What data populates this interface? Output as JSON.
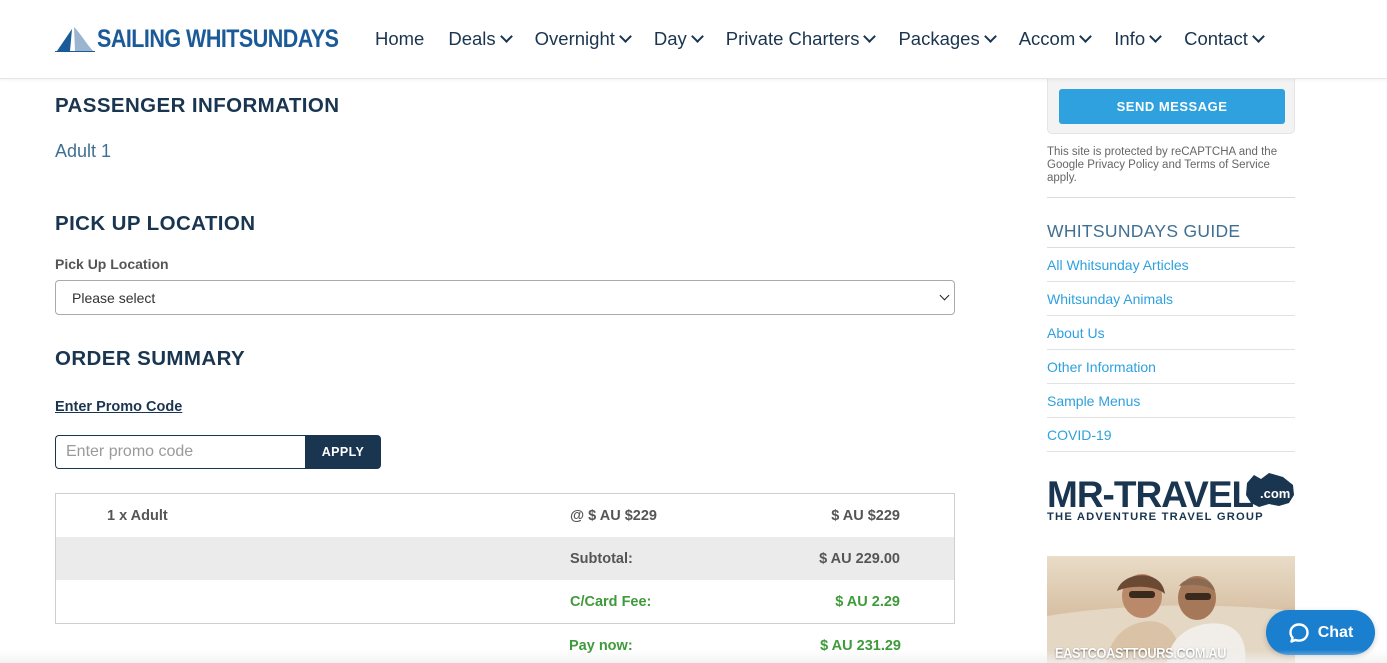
{
  "brand": {
    "name": "SAILING WHITSUNDAYS",
    "color": "#1b5a99"
  },
  "nav": {
    "items": [
      {
        "label": "Home",
        "dropdown": false
      },
      {
        "label": "Deals",
        "dropdown": true
      },
      {
        "label": "Overnight",
        "dropdown": true
      },
      {
        "label": "Day",
        "dropdown": true
      },
      {
        "label": "Private Charters",
        "dropdown": true
      },
      {
        "label": "Packages",
        "dropdown": true
      },
      {
        "label": "Accom",
        "dropdown": true
      },
      {
        "label": "Info",
        "dropdown": true
      },
      {
        "label": "Contact",
        "dropdown": true
      }
    ]
  },
  "passenger": {
    "heading": "PASSENGER INFORMATION",
    "adult": "Adult 1"
  },
  "pickup": {
    "heading": "PICK UP LOCATION",
    "label": "Pick Up Location",
    "selected": "Please select"
  },
  "order": {
    "heading": "ORDER SUMMARY",
    "promo_link": "Enter Promo Code",
    "promo_placeholder": "Enter promo code",
    "apply_label": "APPLY",
    "line": {
      "item": "1 x Adult",
      "unit": "@ $ AU $229",
      "total": "$ AU $229"
    },
    "subtotal": {
      "label": "Subtotal:",
      "value": "$ AU 229.00"
    },
    "card_fee": {
      "label": "C/Card Fee:",
      "value": "$ AU 2.29"
    },
    "pay_now": {
      "label": "Pay now:",
      "value": "$ AU 231.29"
    }
  },
  "sidebar": {
    "send_label": "SEND MESSAGE",
    "recaptcha": "This site is protected by reCAPTCHA and the Google Privacy Policy and Terms of Service apply.",
    "guide_title": "WHITSUNDAYS GUIDE",
    "guide_items": [
      "All Whitsunday Articles",
      "Whitsunday Animals",
      "About Us",
      "Other Information",
      "Sample Menus",
      "COVID-19"
    ],
    "mr_travel": {
      "name": "MR-TRAVEL",
      "tld": ".com",
      "tagline": "THE ADVENTURE TRAVEL GROUP"
    },
    "promo_caption": "EASTCOASTTOURS.COM.AU"
  },
  "chat": {
    "label": "Chat"
  },
  "colors": {
    "navy": "#1a3550",
    "accent_blue": "#2ea1de",
    "green": "#3e9a3a",
    "chat_blue": "#1a7fcf"
  }
}
